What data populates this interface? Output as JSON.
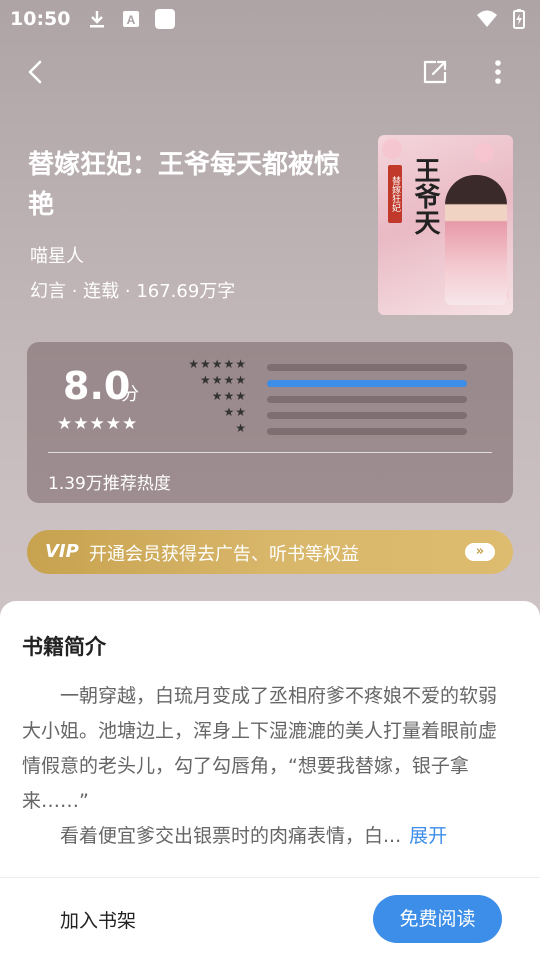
{
  "status_bar": {
    "time": "10:50",
    "icons_left": [
      "download-icon",
      "a-icon",
      "square-icon"
    ],
    "icons_right": [
      "wifi-icon",
      "battery-charging-icon"
    ]
  },
  "toolbar": {
    "back_icon": "back-icon",
    "share_icon": "share-icon",
    "more_icon": "more-icon"
  },
  "book": {
    "title": "替嫁狂妃：王爷每天都被惊艳",
    "author": "喵星人",
    "meta": "幻言 · 连载 · 167.69万字",
    "cover_title": "王爷天",
    "cover_badge": "替嫁狂妃"
  },
  "rating": {
    "score": "8.0",
    "unit": "分",
    "score_stars": "★★★★★",
    "distribution": [
      {
        "stars": "★★★★★",
        "fraction": 0.0
      },
      {
        "stars": "★★★★",
        "fraction": 1.0
      },
      {
        "stars": "★★★",
        "fraction": 0.0
      },
      {
        "stars": "★★",
        "fraction": 0.0
      },
      {
        "stars": "★",
        "fraction": 0.0
      }
    ],
    "hot": "1.39万推荐热度"
  },
  "vip": {
    "logo": "VIP",
    "text": "开通会员获得去广告、听书等权益",
    "arrow": "»"
  },
  "intro": {
    "title": "书籍简介",
    "paragraph1": "一朝穿越，白琉月变成了丞相府爹不疼娘不爱的软弱大小姐。池塘边上，浑身上下湿漉漉的美人打量着眼前虚情假意的老头儿，勾了勾唇角，“想要我替嫁，银子拿来……”",
    "paragraph2": "看着便宜爹交出银票时的肉痛表情，白...",
    "expand": "展开"
  },
  "bottom": {
    "shelf": "加入书架",
    "read": "免费阅读"
  },
  "colors": {
    "accent": "#3d8ee8",
    "vip_gold": "#d4b062"
  }
}
